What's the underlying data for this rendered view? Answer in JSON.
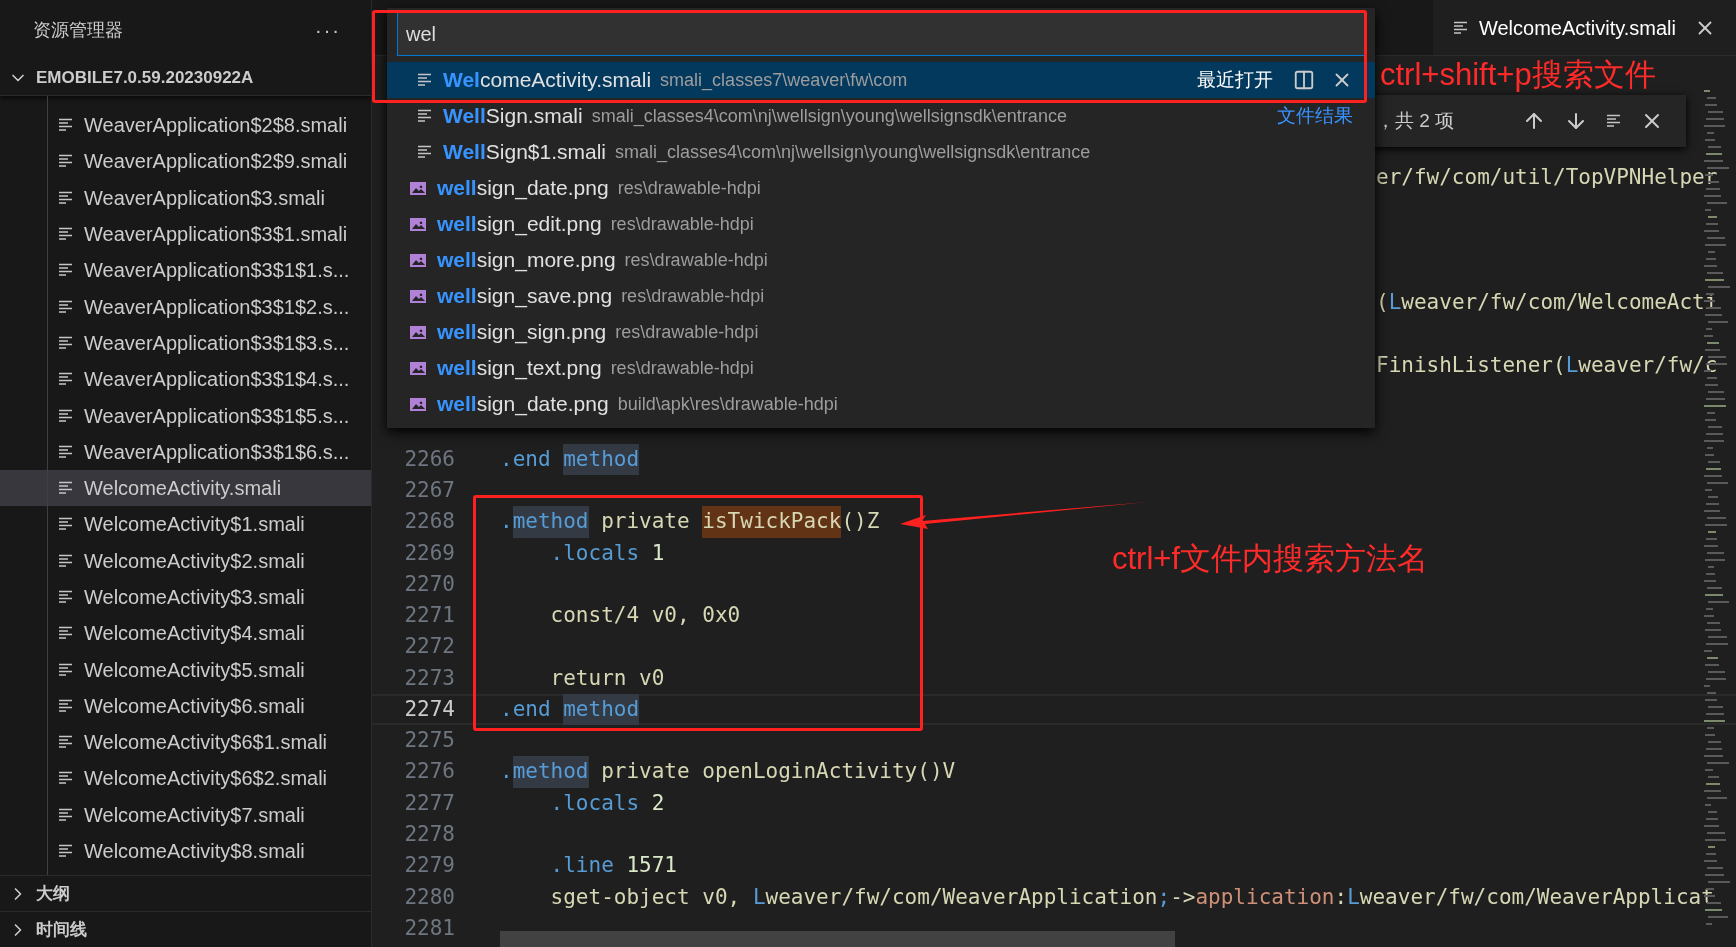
{
  "sidebar": {
    "title": "资源管理器",
    "more": "···",
    "project": {
      "name": "EMOBILE7.0.59.20230922A",
      "expanded": true
    },
    "items": [
      {
        "label": "WeaverApplication$2$8.smali",
        "selected": false
      },
      {
        "label": "WeaverApplication$2$9.smali",
        "selected": false
      },
      {
        "label": "WeaverApplication$3.smali",
        "selected": false
      },
      {
        "label": "WeaverApplication$3$1.smali",
        "selected": false
      },
      {
        "label": "WeaverApplication$3$1$1.s...",
        "selected": false
      },
      {
        "label": "WeaverApplication$3$1$2.s...",
        "selected": false
      },
      {
        "label": "WeaverApplication$3$1$3.s...",
        "selected": false
      },
      {
        "label": "WeaverApplication$3$1$4.s...",
        "selected": false
      },
      {
        "label": "WeaverApplication$3$1$5.s...",
        "selected": false
      },
      {
        "label": "WeaverApplication$3$1$6.s...",
        "selected": false
      },
      {
        "label": "WelcomeActivity.smali",
        "selected": true
      },
      {
        "label": "WelcomeActivity$1.smali",
        "selected": false
      },
      {
        "label": "WelcomeActivity$2.smali",
        "selected": false
      },
      {
        "label": "WelcomeActivity$3.smali",
        "selected": false
      },
      {
        "label": "WelcomeActivity$4.smali",
        "selected": false
      },
      {
        "label": "WelcomeActivity$5.smali",
        "selected": false
      },
      {
        "label": "WelcomeActivity$6.smali",
        "selected": false
      },
      {
        "label": "WelcomeActivity$6$1.smali",
        "selected": false
      },
      {
        "label": "WelcomeActivity$6$2.smali",
        "selected": false
      },
      {
        "label": "WelcomeActivity$7.smali",
        "selected": false
      },
      {
        "label": "WelcomeActivity$8.smali",
        "selected": false
      }
    ],
    "sections": [
      {
        "label": "大纲",
        "expanded": false
      },
      {
        "label": "时间线",
        "expanded": false
      }
    ]
  },
  "editor": {
    "tab": {
      "label": "WelcomeActivity.smali"
    },
    "find_widget": {
      "result": "，共 2 项"
    },
    "covered_lines": [
      {
        "kind": "blank"
      },
      {
        "kind": "blank"
      },
      {
        "kind": "code",
        "fragment": [
          {
            "text": "er/fw/com/util/TopVPNHelper",
            "kind": "text"
          }
        ]
      },
      {
        "kind": "blank"
      },
      {
        "kind": "blank"
      },
      {
        "kind": "blank"
      },
      {
        "kind": "code",
        "fragment": [
          {
            "text": "(",
            "kind": "text"
          },
          {
            "text": "L",
            "kind": "directive"
          },
          {
            "text": "weaver/fw/com/WelcomeActi",
            "kind": "text"
          }
        ]
      },
      {
        "kind": "blank"
      },
      {
        "kind": "code",
        "fragment": [
          {
            "text": "FinishListener(",
            "kind": "text"
          },
          {
            "text": "L",
            "kind": "directive"
          },
          {
            "text": "weaver/fw/c",
            "kind": "text"
          }
        ]
      },
      {
        "kind": "blank"
      },
      {
        "kind": "blank"
      }
    ],
    "lines": [
      {
        "number": "2266",
        "current": false,
        "tokens": [
          {
            "text": ".end ",
            "kind": "directive"
          },
          {
            "text": "method",
            "kind": "directive",
            "occurrence": true
          }
        ]
      },
      {
        "number": "2267",
        "current": false
      },
      {
        "number": "2268",
        "current": false,
        "tokens": [
          {
            "text": ".",
            "kind": "directive"
          },
          {
            "text": "method",
            "kind": "directive",
            "occurrence": true
          },
          {
            "text": " private ",
            "kind": "text"
          },
          {
            "text": "isTwickPack",
            "kind": "text",
            "match": true
          },
          {
            "text": "()Z",
            "kind": "text"
          }
        ]
      },
      {
        "number": "2269",
        "current": false,
        "tokens": [
          {
            "text": "    .locals ",
            "kind": "directive"
          },
          {
            "text": "1",
            "kind": "number"
          }
        ]
      },
      {
        "number": "2270",
        "current": false
      },
      {
        "number": "2271",
        "current": false,
        "tokens": [
          {
            "text": "    const/4 v0, 0x0",
            "kind": "text"
          }
        ]
      },
      {
        "number": "2272",
        "current": false
      },
      {
        "number": "2273",
        "current": false,
        "tokens": [
          {
            "text": "    return v0",
            "kind": "text"
          }
        ]
      },
      {
        "number": "2274",
        "current": true,
        "tokens": [
          {
            "text": ".end ",
            "kind": "directive"
          },
          {
            "text": "method",
            "kind": "directive",
            "occurrence": true
          }
        ]
      },
      {
        "number": "2275",
        "current": false
      },
      {
        "number": "2276",
        "current": false,
        "tokens": [
          {
            "text": ".",
            "kind": "directive"
          },
          {
            "text": "method",
            "kind": "directive",
            "occurrence": true
          },
          {
            "text": " private openLoginActivity()V",
            "kind": "text"
          }
        ]
      },
      {
        "number": "2277",
        "current": false,
        "tokens": [
          {
            "text": "    .locals ",
            "kind": "directive"
          },
          {
            "text": "2",
            "kind": "number"
          }
        ]
      },
      {
        "number": "2278",
        "current": false
      },
      {
        "number": "2279",
        "current": false,
        "tokens": [
          {
            "text": "    .line ",
            "kind": "directive"
          },
          {
            "text": "1571",
            "kind": "number"
          }
        ]
      },
      {
        "number": "2280",
        "current": false,
        "tokens": [
          {
            "text": "    sget-object v0, ",
            "kind": "text"
          },
          {
            "text": "L",
            "kind": "directive"
          },
          {
            "text": "weaver/fw/com/WeaverApplication",
            "kind": "text"
          },
          {
            "text": ";",
            "kind": "directive"
          },
          {
            "text": "->",
            "kind": "text"
          },
          {
            "text": "application",
            "kind": "field"
          },
          {
            "text": ":",
            "kind": "text"
          },
          {
            "text": "L",
            "kind": "directive"
          },
          {
            "text": "weaver/fw/com/WeaverApplicat",
            "kind": "text"
          }
        ]
      },
      {
        "number": "2281",
        "current": false
      }
    ]
  },
  "quick_open": {
    "query": "wel",
    "results": [
      {
        "kind": "file",
        "name": "**Wel**comeActivity.smali",
        "path": "smali_classes7\\weaver\\fw\\com",
        "selected": true,
        "label": "最近打开"
      },
      {
        "kind": "file",
        "name": "**Well**Sign.smali",
        "path": "smali_classes4\\com\\nj\\wellsign\\young\\wellsignsdk\\entrance",
        "selected": false,
        "label": "文件结果"
      },
      {
        "kind": "file",
        "name": "**Well**Sign$1.smali",
        "path": "smali_classes4\\com\\nj\\wellsign\\young\\wellsignsdk\\entrance",
        "selected": false
      },
      {
        "kind": "image",
        "name": "**well**sign_date.png",
        "path": "res\\drawable-hdpi",
        "selected": false
      },
      {
        "kind": "image",
        "name": "**well**sign_edit.png",
        "path": "res\\drawable-hdpi",
        "selected": false
      },
      {
        "kind": "image",
        "name": "**well**sign_more.png",
        "path": "res\\drawable-hdpi",
        "selected": false
      },
      {
        "kind": "image",
        "name": "**well**sign_save.png",
        "path": "res\\drawable-hdpi",
        "selected": false
      },
      {
        "kind": "image",
        "name": "**well**sign_sign.png",
        "path": "res\\drawable-hdpi",
        "selected": false
      },
      {
        "kind": "image",
        "name": "**well**sign_text.png",
        "path": "res\\drawable-hdpi",
        "selected": false
      },
      {
        "kind": "image",
        "name": "**well**sign_date.png",
        "path": "build\\apk\\res\\drawable-hdpi",
        "selected": false
      }
    ]
  },
  "annotations": [
    {
      "text": "ctrl+shift+p搜索文件"
    },
    {
      "text": "ctrl+f文件内搜索方法名"
    }
  ]
}
